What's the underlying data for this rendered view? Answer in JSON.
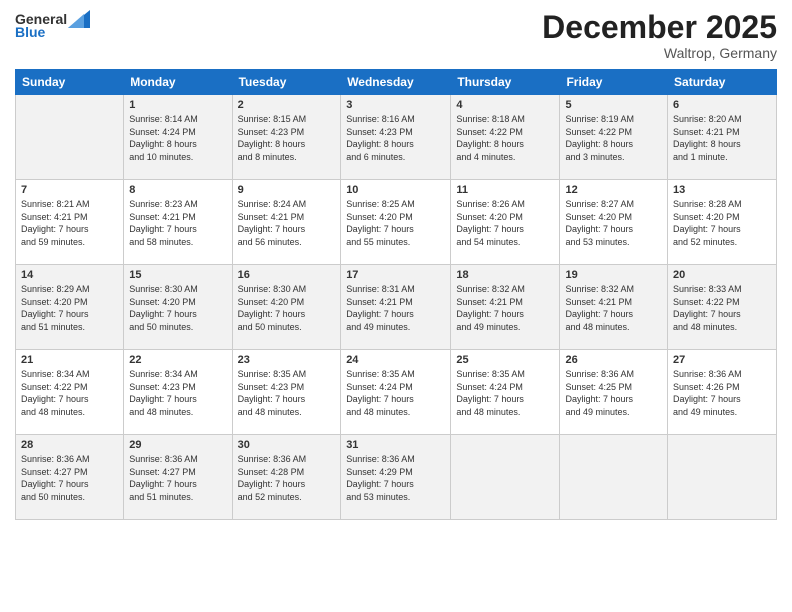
{
  "header": {
    "logo_general": "General",
    "logo_blue": "Blue",
    "month_title": "December 2025",
    "location": "Waltrop, Germany"
  },
  "days_of_week": [
    "Sunday",
    "Monday",
    "Tuesday",
    "Wednesday",
    "Thursday",
    "Friday",
    "Saturday"
  ],
  "weeks": [
    [
      {
        "day": "",
        "info": ""
      },
      {
        "day": "1",
        "info": "Sunrise: 8:14 AM\nSunset: 4:24 PM\nDaylight: 8 hours\nand 10 minutes."
      },
      {
        "day": "2",
        "info": "Sunrise: 8:15 AM\nSunset: 4:23 PM\nDaylight: 8 hours\nand 8 minutes."
      },
      {
        "day": "3",
        "info": "Sunrise: 8:16 AM\nSunset: 4:23 PM\nDaylight: 8 hours\nand 6 minutes."
      },
      {
        "day": "4",
        "info": "Sunrise: 8:18 AM\nSunset: 4:22 PM\nDaylight: 8 hours\nand 4 minutes."
      },
      {
        "day": "5",
        "info": "Sunrise: 8:19 AM\nSunset: 4:22 PM\nDaylight: 8 hours\nand 3 minutes."
      },
      {
        "day": "6",
        "info": "Sunrise: 8:20 AM\nSunset: 4:21 PM\nDaylight: 8 hours\nand 1 minute."
      }
    ],
    [
      {
        "day": "7",
        "info": "Sunrise: 8:21 AM\nSunset: 4:21 PM\nDaylight: 7 hours\nand 59 minutes."
      },
      {
        "day": "8",
        "info": "Sunrise: 8:23 AM\nSunset: 4:21 PM\nDaylight: 7 hours\nand 58 minutes."
      },
      {
        "day": "9",
        "info": "Sunrise: 8:24 AM\nSunset: 4:21 PM\nDaylight: 7 hours\nand 56 minutes."
      },
      {
        "day": "10",
        "info": "Sunrise: 8:25 AM\nSunset: 4:20 PM\nDaylight: 7 hours\nand 55 minutes."
      },
      {
        "day": "11",
        "info": "Sunrise: 8:26 AM\nSunset: 4:20 PM\nDaylight: 7 hours\nand 54 minutes."
      },
      {
        "day": "12",
        "info": "Sunrise: 8:27 AM\nSunset: 4:20 PM\nDaylight: 7 hours\nand 53 minutes."
      },
      {
        "day": "13",
        "info": "Sunrise: 8:28 AM\nSunset: 4:20 PM\nDaylight: 7 hours\nand 52 minutes."
      }
    ],
    [
      {
        "day": "14",
        "info": "Sunrise: 8:29 AM\nSunset: 4:20 PM\nDaylight: 7 hours\nand 51 minutes."
      },
      {
        "day": "15",
        "info": "Sunrise: 8:30 AM\nSunset: 4:20 PM\nDaylight: 7 hours\nand 50 minutes."
      },
      {
        "day": "16",
        "info": "Sunrise: 8:30 AM\nSunset: 4:20 PM\nDaylight: 7 hours\nand 50 minutes."
      },
      {
        "day": "17",
        "info": "Sunrise: 8:31 AM\nSunset: 4:21 PM\nDaylight: 7 hours\nand 49 minutes."
      },
      {
        "day": "18",
        "info": "Sunrise: 8:32 AM\nSunset: 4:21 PM\nDaylight: 7 hours\nand 49 minutes."
      },
      {
        "day": "19",
        "info": "Sunrise: 8:32 AM\nSunset: 4:21 PM\nDaylight: 7 hours\nand 48 minutes."
      },
      {
        "day": "20",
        "info": "Sunrise: 8:33 AM\nSunset: 4:22 PM\nDaylight: 7 hours\nand 48 minutes."
      }
    ],
    [
      {
        "day": "21",
        "info": "Sunrise: 8:34 AM\nSunset: 4:22 PM\nDaylight: 7 hours\nand 48 minutes."
      },
      {
        "day": "22",
        "info": "Sunrise: 8:34 AM\nSunset: 4:23 PM\nDaylight: 7 hours\nand 48 minutes."
      },
      {
        "day": "23",
        "info": "Sunrise: 8:35 AM\nSunset: 4:23 PM\nDaylight: 7 hours\nand 48 minutes."
      },
      {
        "day": "24",
        "info": "Sunrise: 8:35 AM\nSunset: 4:24 PM\nDaylight: 7 hours\nand 48 minutes."
      },
      {
        "day": "25",
        "info": "Sunrise: 8:35 AM\nSunset: 4:24 PM\nDaylight: 7 hours\nand 48 minutes."
      },
      {
        "day": "26",
        "info": "Sunrise: 8:36 AM\nSunset: 4:25 PM\nDaylight: 7 hours\nand 49 minutes."
      },
      {
        "day": "27",
        "info": "Sunrise: 8:36 AM\nSunset: 4:26 PM\nDaylight: 7 hours\nand 49 minutes."
      }
    ],
    [
      {
        "day": "28",
        "info": "Sunrise: 8:36 AM\nSunset: 4:27 PM\nDaylight: 7 hours\nand 50 minutes."
      },
      {
        "day": "29",
        "info": "Sunrise: 8:36 AM\nSunset: 4:27 PM\nDaylight: 7 hours\nand 51 minutes."
      },
      {
        "day": "30",
        "info": "Sunrise: 8:36 AM\nSunset: 4:28 PM\nDaylight: 7 hours\nand 52 minutes."
      },
      {
        "day": "31",
        "info": "Sunrise: 8:36 AM\nSunset: 4:29 PM\nDaylight: 7 hours\nand 53 minutes."
      },
      {
        "day": "",
        "info": ""
      },
      {
        "day": "",
        "info": ""
      },
      {
        "day": "",
        "info": ""
      }
    ]
  ]
}
